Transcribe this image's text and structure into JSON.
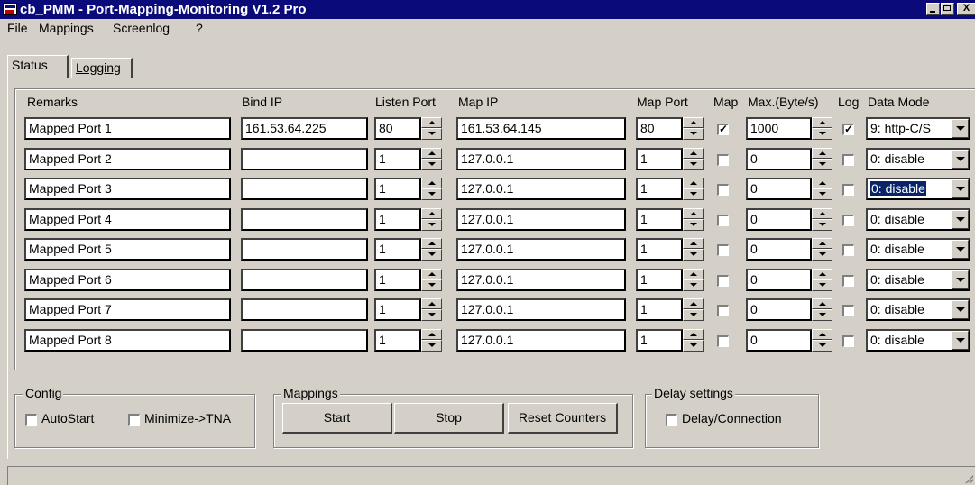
{
  "window": {
    "title": "cb_PMM - Port-Mapping-Monitoring V1.2 Pro",
    "controls": {
      "minimize": "_",
      "maximize": "□",
      "close": "X"
    }
  },
  "menu": [
    "File",
    "Mappings",
    "Screenlog",
    "?"
  ],
  "tabs": [
    "Status",
    "Logging"
  ],
  "headers": {
    "remarks": "Remarks",
    "bind_ip": "Bind IP",
    "listen_port": "Listen Port",
    "map_ip": "Map IP",
    "map_port": "Map Port",
    "map": "Map",
    "max": "Max.(Byte/s)",
    "log": "Log",
    "data_mode": "Data Mode"
  },
  "rows": [
    {
      "remarks": "Mapped Port 1",
      "bind_ip": "161.53.64.225",
      "listen_port": "80",
      "map_ip": "161.53.64.145",
      "map_port": "80",
      "map": true,
      "max": "1000",
      "log": true,
      "data_mode": "9: http-C/S",
      "data_mode_selected": false
    },
    {
      "remarks": "Mapped Port 2",
      "bind_ip": "",
      "listen_port": "1",
      "map_ip": "127.0.0.1",
      "map_port": "1",
      "map": false,
      "max": "0",
      "log": false,
      "data_mode": "0: disable",
      "data_mode_selected": false
    },
    {
      "remarks": "Mapped Port 3",
      "bind_ip": "",
      "listen_port": "1",
      "map_ip": "127.0.0.1",
      "map_port": "1",
      "map": false,
      "max": "0",
      "log": false,
      "data_mode": "0: disable",
      "data_mode_selected": true
    },
    {
      "remarks": "Mapped Port 4",
      "bind_ip": "",
      "listen_port": "1",
      "map_ip": "127.0.0.1",
      "map_port": "1",
      "map": false,
      "max": "0",
      "log": false,
      "data_mode": "0: disable",
      "data_mode_selected": false
    },
    {
      "remarks": "Mapped Port 5",
      "bind_ip": "",
      "listen_port": "1",
      "map_ip": "127.0.0.1",
      "map_port": "1",
      "map": false,
      "max": "0",
      "log": false,
      "data_mode": "0: disable",
      "data_mode_selected": false
    },
    {
      "remarks": "Mapped Port 6",
      "bind_ip": "",
      "listen_port": "1",
      "map_ip": "127.0.0.1",
      "map_port": "1",
      "map": false,
      "max": "0",
      "log": false,
      "data_mode": "0: disable",
      "data_mode_selected": false
    },
    {
      "remarks": "Mapped Port 7",
      "bind_ip": "",
      "listen_port": "1",
      "map_ip": "127.0.0.1",
      "map_port": "1",
      "map": false,
      "max": "0",
      "log": false,
      "data_mode": "0: disable",
      "data_mode_selected": false
    },
    {
      "remarks": "Mapped Port 8",
      "bind_ip": "",
      "listen_port": "1",
      "map_ip": "127.0.0.1",
      "map_port": "1",
      "map": false,
      "max": "0",
      "log": false,
      "data_mode": "0: disable",
      "data_mode_selected": false
    }
  ],
  "config": {
    "label": "Config",
    "autostart_label": "AutoStart",
    "autostart": false,
    "minimize_label": "Minimize->TNA",
    "minimize": false
  },
  "mappings_group": {
    "label": "Mappings",
    "start": "Start",
    "stop": "Stop",
    "reset": "Reset Counters"
  },
  "delay": {
    "label": "Delay settings",
    "delay_label": "Delay/Connection",
    "delay": false
  }
}
